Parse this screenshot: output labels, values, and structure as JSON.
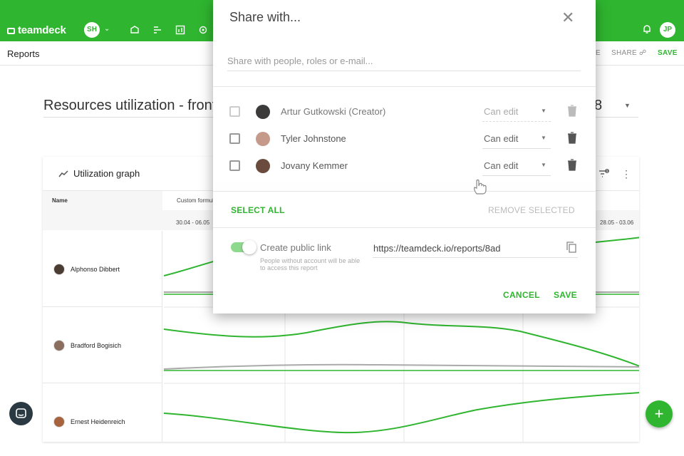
{
  "app": {
    "brand": "teamdeck",
    "workspace_initials": "SH",
    "user_initials": "JP",
    "accent": "#2fb52f"
  },
  "subheader": {
    "breadcrumb": "Reports",
    "view_label": "E",
    "share_label": "SHARE",
    "save_label": "SAVE"
  },
  "report": {
    "title": "Resources utilization - fronte",
    "title_tail": "8"
  },
  "card": {
    "title": "Utilization graph",
    "filter_count": "1",
    "name_header": "Name",
    "formula_header": "Custom formul",
    "date_start": "30.04 - 06.05",
    "date_end": "28.05 - 03.06",
    "people": [
      {
        "name": "Alphonso Dibbert"
      },
      {
        "name": "Bradford Bogisich"
      },
      {
        "name": "Ernest Heidenreich"
      }
    ]
  },
  "modal": {
    "title": "Share with...",
    "search_placeholder": "Share with people, roles or e-mail...",
    "users": [
      {
        "name": "Artur Gutkowski (Creator)",
        "permission": "Can edit",
        "disabled": true
      },
      {
        "name": "Tyler Johnstone",
        "permission": "Can edit",
        "disabled": false
      },
      {
        "name": "Jovany Kemmer",
        "permission": "Can edit",
        "disabled": false
      }
    ],
    "select_all_label": "SELECT ALL",
    "remove_selected_label": "REMOVE SELECTED",
    "public_link": {
      "enabled": true,
      "label": "Create public link",
      "help": "People without account will be able to access this report",
      "url": "https://teamdeck.io/reports/8ad"
    },
    "cancel_label": "CANCEL",
    "save_label": "SAVE"
  },
  "icons": [
    "logo-icon",
    "chevron-down-icon",
    "bell-icon",
    "graph-icon",
    "filter-icon",
    "more-icon",
    "close-icon",
    "caret-down-icon",
    "trash-icon",
    "copy-icon",
    "chat-icon",
    "plus-icon",
    "hand-cursor-icon"
  ]
}
